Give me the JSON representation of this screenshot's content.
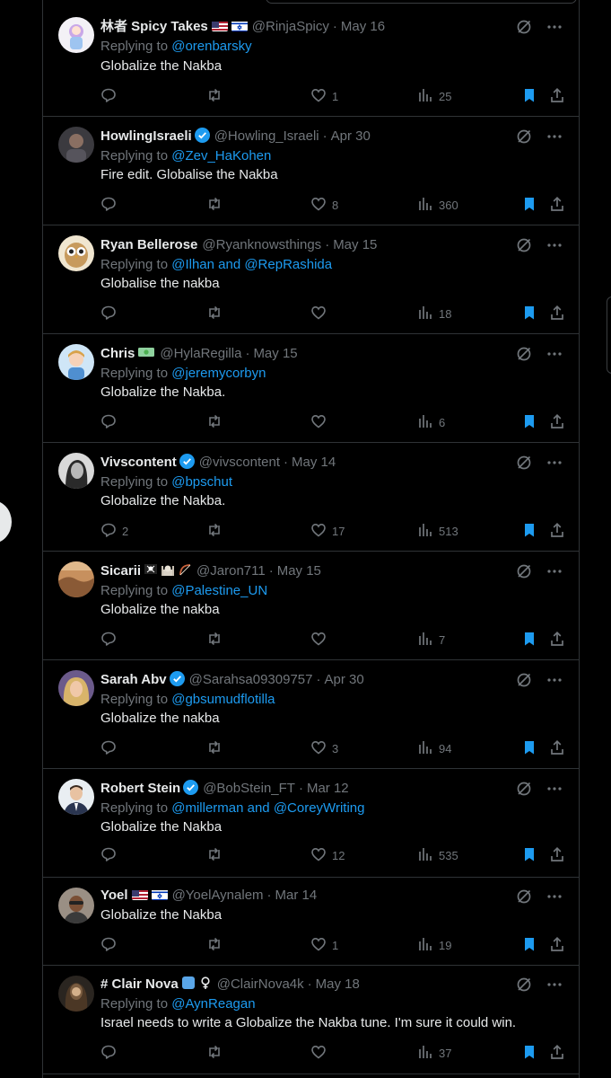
{
  "colors": {
    "background": "#000000",
    "text": "#e7e9ea",
    "muted": "#71767b",
    "link": "#1d9bf0",
    "bookmark": "#1d9bf0",
    "border": "#2f3336"
  },
  "tweets": [
    {
      "name": "林者 Spicy Takes",
      "badges": [
        "flag-us",
        "flag-il"
      ],
      "verified": false,
      "handle": "@RinjaSpicy",
      "date": "May 16",
      "reply_prefix": "Replying to ",
      "reply_to": "@orenbarsky",
      "text": "Globalize the Nakba",
      "replies": "",
      "retweets": "",
      "likes": "1",
      "views": "25",
      "bookmarked": true,
      "avatar": "anime-avatar"
    },
    {
      "name": "HowlingIsraeli",
      "badges": [],
      "verified": true,
      "handle": "@Howling_Israeli",
      "date": "Apr 30",
      "reply_prefix": "Replying to ",
      "reply_to": "@Zev_HaKohen",
      "text": "Fire edit. Globalise the Nakba",
      "replies": "",
      "retweets": "",
      "likes": "8",
      "views": "360",
      "bookmarked": true,
      "avatar": "person-avatar"
    },
    {
      "name": "Ryan Bellerose",
      "badges": [],
      "verified": false,
      "handle": "@Ryanknowsthings",
      "date": "May 15",
      "reply_prefix": "Replying to ",
      "reply_to": "@Ilhan and @RepRashida",
      "text": "Globalise the nakba",
      "replies": "",
      "retweets": "",
      "likes": "",
      "views": "18",
      "bookmarked": true,
      "avatar": "owl-avatar"
    },
    {
      "name": "Chris",
      "badges": [
        "cash-emoji"
      ],
      "verified": false,
      "handle": "@HylaRegilla",
      "date": "May 15",
      "reply_prefix": "Replying to ",
      "reply_to": "@jeremycorbyn",
      "text": "Globalize the Nakba.",
      "replies": "",
      "retweets": "",
      "likes": "",
      "views": "6",
      "bookmarked": true,
      "avatar": "cartoon-avatar"
    },
    {
      "name": "Vivscontent",
      "badges": [],
      "verified": true,
      "handle": "@vivscontent",
      "date": "May 14",
      "reply_prefix": "Replying to ",
      "reply_to": "@bpschut",
      "text": "Globalize the Nakba.",
      "replies": "2",
      "retweets": "",
      "likes": "17",
      "views": "513",
      "bookmarked": true,
      "avatar": "bw-portrait-avatar"
    },
    {
      "name": "Sicarii",
      "badges": [
        "pirate-flag-emoji",
        "mosque-emoji",
        "bow-emoji"
      ],
      "verified": false,
      "handle": "@Jaron711",
      "date": "May 15",
      "reply_prefix": "Replying to ",
      "reply_to": "@Palestine_UN",
      "text": "Globalize the nakba",
      "replies": "",
      "retweets": "",
      "likes": "",
      "views": "7",
      "bookmarked": true,
      "avatar": "desert-avatar"
    },
    {
      "name": "Sarah Abv",
      "badges": [],
      "verified": true,
      "handle": "@Sarahsa09309757",
      "date": "Apr 30",
      "reply_prefix": "Replying to ",
      "reply_to": "@gbsumudflotilla",
      "text": "Globalize the nakba",
      "replies": "",
      "retweets": "",
      "likes": "3",
      "views": "94",
      "bookmarked": true,
      "avatar": "woman-avatar"
    },
    {
      "name": "Robert Stein",
      "badges": [],
      "verified": true,
      "handle": "@BobStein_FT",
      "date": "Mar 12",
      "reply_prefix": "Replying to ",
      "reply_to": "@millerman and @CoreyWriting",
      "text": "Globalize the Nakba",
      "replies": "",
      "retweets": "",
      "likes": "12",
      "views": "535",
      "bookmarked": true,
      "avatar": "suit-avatar"
    },
    {
      "name": "Yoel",
      "badges": [
        "flag-us",
        "flag-il"
      ],
      "verified": false,
      "handle": "@YoelAynalem",
      "date": "Mar 14",
      "reply_prefix": "",
      "reply_to": "",
      "text": "Globalize the Nakba",
      "replies": "",
      "retweets": "",
      "likes": "1",
      "views": "19",
      "bookmarked": true,
      "avatar": "man-avatar"
    },
    {
      "name": "# Clair Nova",
      "badges": [
        "blue-square-emoji",
        "female-sign-emoji"
      ],
      "verified": false,
      "handle": "@ClairNova4k",
      "date": "May 18",
      "reply_prefix": "Replying to ",
      "reply_to": "@AynReagan",
      "text": "Israel needs to write a Globalize the Nakba tune. I'm sure it could win.",
      "replies": "",
      "retweets": "",
      "likes": "",
      "views": "37",
      "bookmarked": true,
      "avatar": "dark-portrait-avatar"
    }
  ]
}
